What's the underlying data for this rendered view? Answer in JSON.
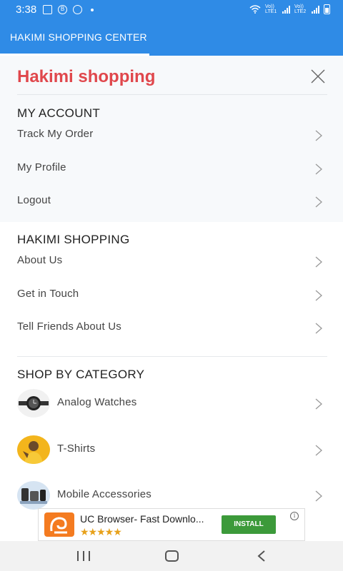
{
  "status_bar": {
    "time": "3:38",
    "icons": [
      "gallery-icon",
      "b-icon",
      "carrier-icon",
      "dot-icon",
      "wifi-icon",
      "signal-lte1-icon",
      "signal-lte2-icon",
      "battery-icon"
    ],
    "lte1": "Vo)) LTE1",
    "lte2": "Vo)) LTE2"
  },
  "app_bar": {
    "title": "HAKIMI SHOPPING CENTER",
    "accent": "#2f8be6"
  },
  "drawer": {
    "header_title": "Hakimi shopping",
    "header_color": "#e0474c",
    "my_account": {
      "title": "MY ACCOUNT",
      "items": [
        {
          "label": "Track My Order"
        },
        {
          "label": "My Profile"
        },
        {
          "label": "Logout"
        }
      ]
    },
    "hakimi_shopping": {
      "title": "HAKIMI SHOPPING",
      "items": [
        {
          "label": "About Us"
        },
        {
          "label": "Get in Touch"
        },
        {
          "label": "Tell Friends About Us"
        }
      ]
    },
    "shop_by_category": {
      "title": "SHOP BY CATEGORY",
      "items": [
        {
          "label": "Analog Watches",
          "icon": "watch-thumbnail"
        },
        {
          "label": "T-Shirts",
          "icon": "tshirt-thumbnail"
        },
        {
          "label": "Mobile Accessories",
          "icon": "accessories-thumbnail"
        }
      ]
    }
  },
  "ad": {
    "title": "UC Browser- Fast Downlo...",
    "stars": "★★★★★",
    "install": "INSTALL",
    "info": "i",
    "install_color": "#3c9a3a"
  }
}
